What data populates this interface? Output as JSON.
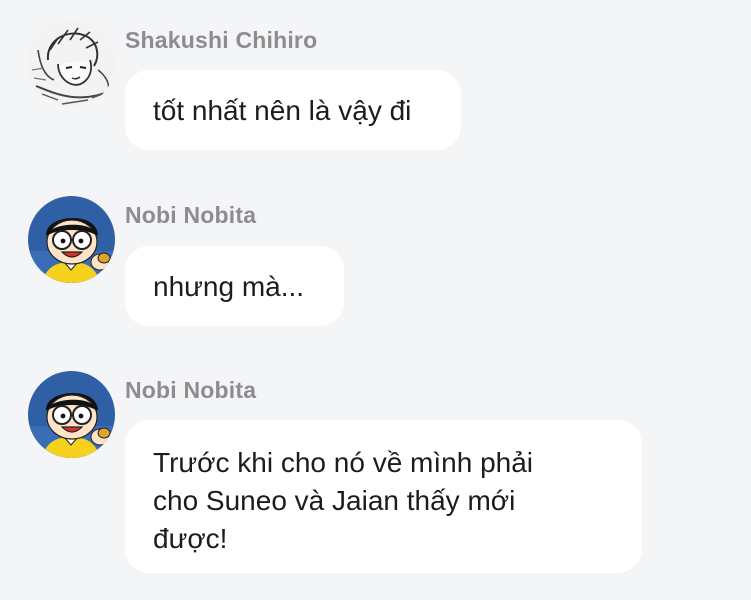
{
  "messages": [
    {
      "sender": "Shakushi Chihiro",
      "avatar_icon": "manga-character-avatar-icon",
      "lines": [
        "tốt nhất nên là vậy đi"
      ]
    },
    {
      "sender": "Nobi Nobita",
      "avatar_icon": "nobita-avatar-icon",
      "lines": [
        "nhưng mà..."
      ]
    },
    {
      "sender": "Nobi Nobita",
      "avatar_icon": "nobita-avatar-icon",
      "lines": [
        "Trước khi cho nó về mình phải",
        "cho Suneo và Jaian thấy mới",
        "được!"
      ]
    }
  ],
  "colors": {
    "background": "#f4f5f7",
    "bubble": "#ffffff",
    "sender_name": "#8d8d8f",
    "message_text": "#1c1c1e"
  }
}
